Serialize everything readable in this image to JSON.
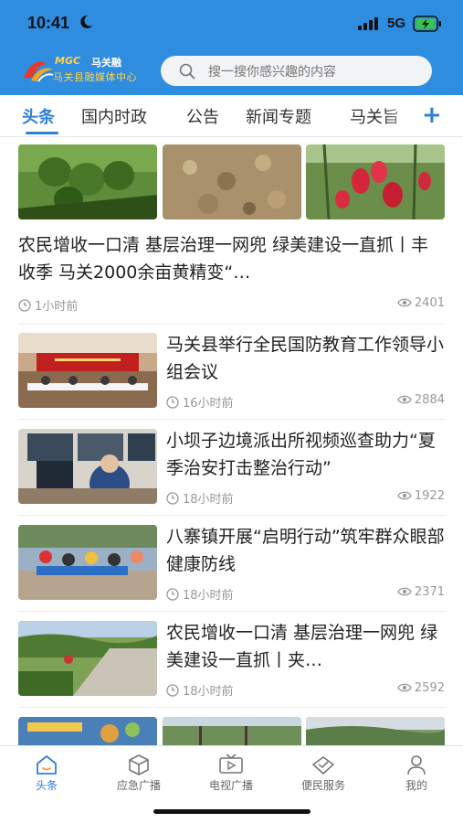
{
  "status": {
    "time": "10:41",
    "network": "5G"
  },
  "header": {
    "logo_en": "MGC",
    "logo_name": "马关融",
    "logo_subtitle": "马关县融媒体中心",
    "search_placeholder": "搜一搜你感兴趣的内容"
  },
  "tabs": [
    "头条",
    "国内时政",
    "公告",
    "新闻专题",
    "马关旨"
  ],
  "articles": [
    {
      "title": "农民增收一口清  基层治理一网兜  绿美建设一直抓丨丰收季  马关2000余亩黄精变“…",
      "time": "1小时前",
      "views": "2401"
    },
    {
      "title": "马关县举行全民国防教育工作领导小组会议",
      "time": "16小时前",
      "views": "2884"
    },
    {
      "title": "小坝子边境派出所视频巡查助力“夏季治安打击整治行动”",
      "time": "18小时前",
      "views": "1922"
    },
    {
      "title": "八寨镇开展“启明行动”筑牢群众眼部健康防线",
      "time": "18小时前",
      "views": "2371"
    },
    {
      "title": "农民增收一口清  基层治理一网兜  绿美建设一直抓丨夹…",
      "time": "18小时前",
      "views": "2592"
    }
  ],
  "bottom_nav": [
    "头条",
    "应急广播",
    "电视广播",
    "便民服务",
    "我的"
  ],
  "colors": {
    "brand": "#2f8de0",
    "accent": "#2f7fd6"
  }
}
